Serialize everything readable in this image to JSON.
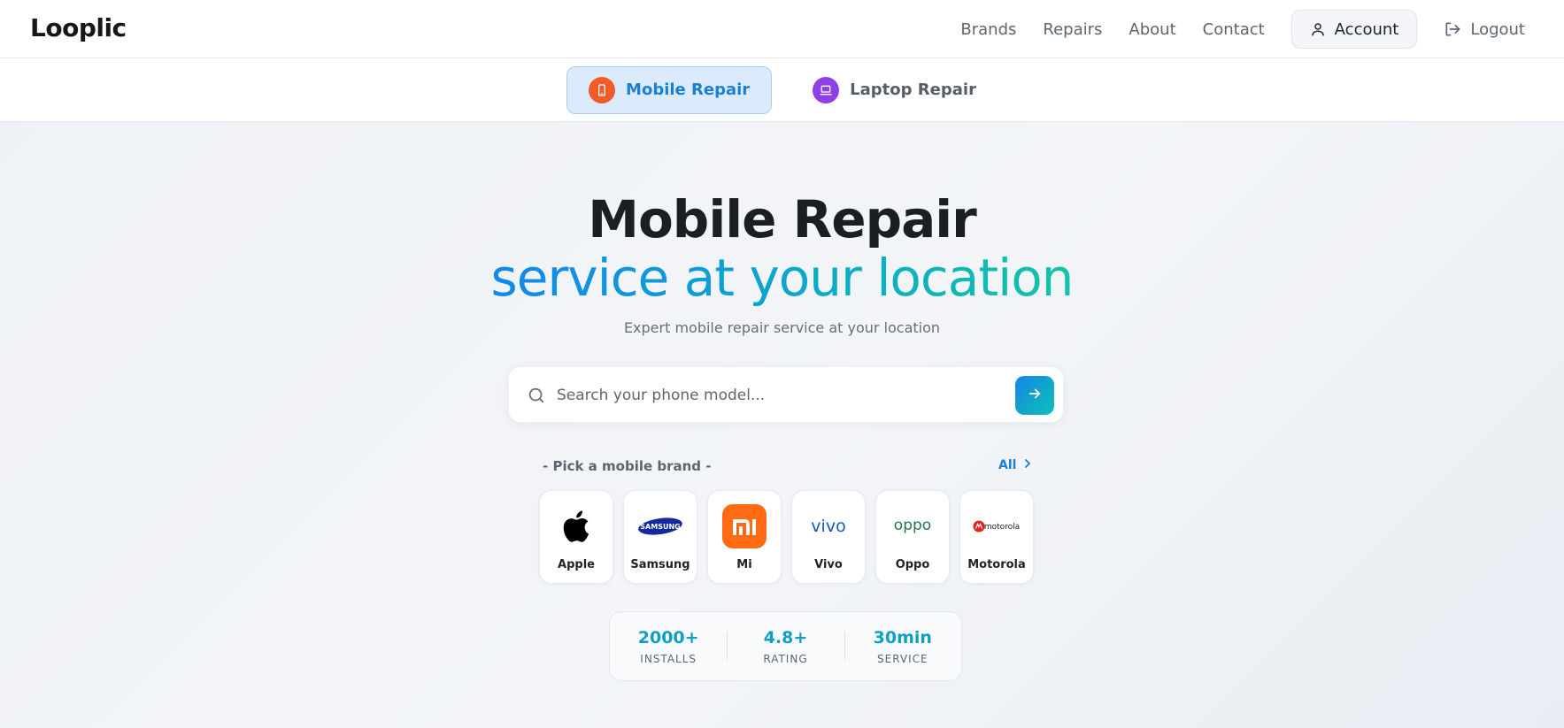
{
  "header": {
    "logo_text": "Looplic",
    "nav": [
      "Brands",
      "Repairs",
      "About",
      "Contact"
    ],
    "account_label": "Account",
    "logout_label": "Logout"
  },
  "tabs": [
    {
      "label": "Mobile Repair",
      "active": true,
      "icon": "phone-icon",
      "color": "#f15a29"
    },
    {
      "label": "Laptop Repair",
      "active": false,
      "icon": "laptop-icon",
      "color": "#8e3fe8"
    }
  ],
  "hero": {
    "title": "Mobile Repair",
    "subtitle": "service at your location",
    "tagline": "Expert mobile repair service at your location"
  },
  "search": {
    "placeholder": "Search your phone model..."
  },
  "brands": {
    "heading": "- Pick a mobile brand -",
    "all_label": "All",
    "items": [
      {
        "name": "Apple",
        "logo": "apple-logo"
      },
      {
        "name": "Samsung",
        "logo": "samsung-logo",
        "logo_text": "SAMSUNG"
      },
      {
        "name": "Mi",
        "logo": "mi-logo",
        "logo_text": "mi"
      },
      {
        "name": "Vivo",
        "logo": "vivo-logo",
        "logo_text": "vivo"
      },
      {
        "name": "Oppo",
        "logo": "oppo-logo",
        "logo_text": "oppo"
      },
      {
        "name": "Motorola",
        "logo": "motorola-logo",
        "logo_text": "motorola"
      }
    ]
  },
  "stats": [
    {
      "value": "2000+",
      "label": "INSTALLS"
    },
    {
      "value": "4.8+",
      "label": "RATING"
    },
    {
      "value": "30min",
      "label": "SERVICE"
    }
  ],
  "colors": {
    "accent": "#1a7fd9",
    "accent_teal": "#14c3a8",
    "mi_orange": "#ff6a13"
  }
}
